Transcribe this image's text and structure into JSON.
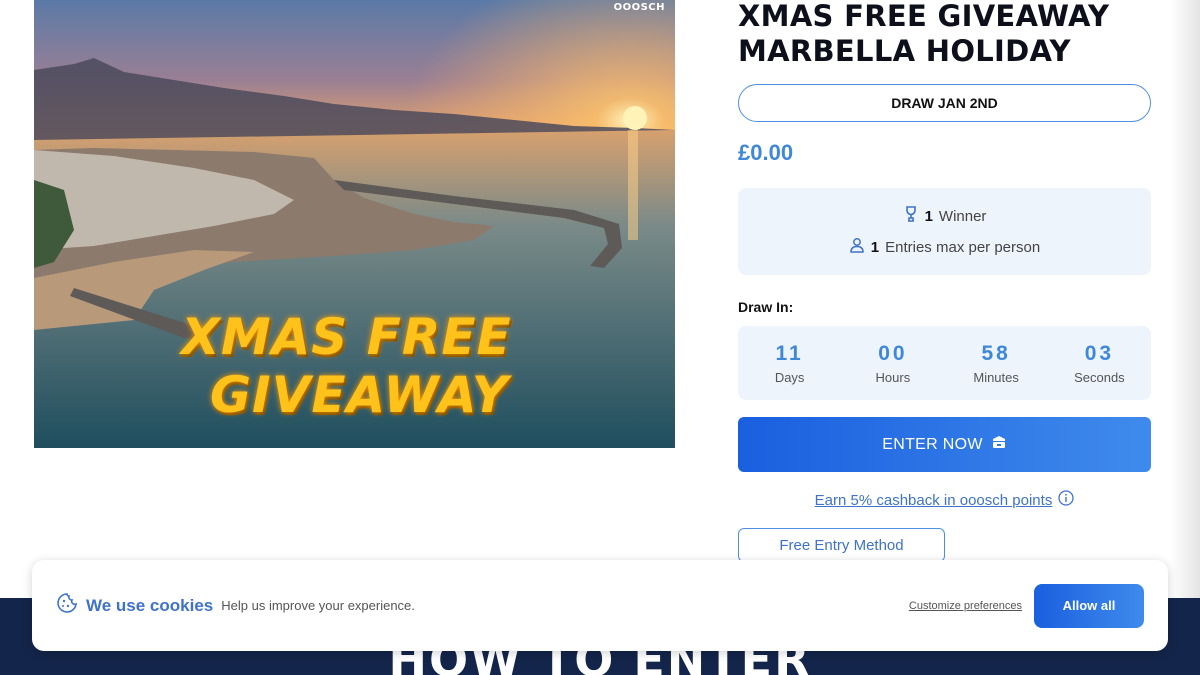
{
  "hero": {
    "brand": "OOOSCH",
    "overlay_line1": "XMAS FREE",
    "overlay_line2": "GIVEAWAY"
  },
  "product": {
    "title_line1": "XMAS FREE GIVEAWAY",
    "title_line2": "MARBELLA HOLIDAY",
    "draw_date": "DRAW JAN 2ND",
    "price": "£0.00",
    "winners_count": "1",
    "winners_label": "Winner",
    "entries_count": "1",
    "entries_label": "Entries max per person",
    "draw_in_label": "Draw In:"
  },
  "countdown": [
    {
      "value": "11",
      "label": "Days"
    },
    {
      "value": "00",
      "label": "Hours"
    },
    {
      "value": "58",
      "label": "Minutes"
    },
    {
      "value": "03",
      "label": "Seconds"
    }
  ],
  "actions": {
    "enter_label": "ENTER NOW",
    "cashback_label": "Earn 5% cashback in ooosch points",
    "free_entry_label": "Free Entry Method"
  },
  "section": {
    "how_to_enter": "HOW TO ENTER"
  },
  "cookie": {
    "title": "We use cookies",
    "text": "Help us improve your experience.",
    "customize_label": "Customize preferences",
    "allow_label": "Allow all"
  },
  "colors": {
    "accent": "#3f87d9",
    "button_start": "#1a5fdf",
    "button_end": "#3f8bec",
    "band": "#13254a"
  },
  "icons": {
    "winner": "trophy-icon",
    "entries": "user-icon",
    "enter": "ticket-icon",
    "info": "info-icon",
    "cookie": "cookie-icon"
  }
}
